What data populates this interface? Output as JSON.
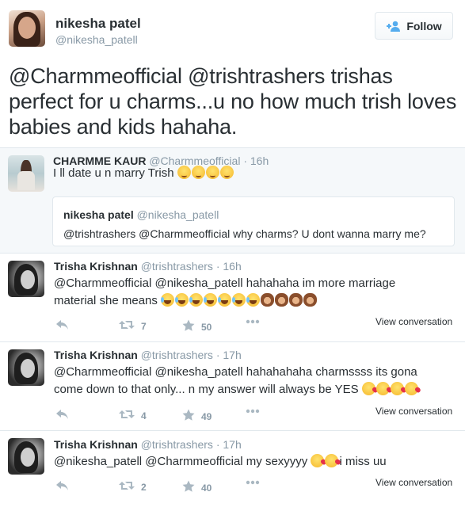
{
  "main_tweet": {
    "author_name": "nikesha patel",
    "author_handle": "@nikesha_patell",
    "follow_label": "Follow",
    "text": "@Charmmeofficial @trishtrashers trishas perfect for u charms...u no how much trish loves babies and kids hahaha."
  },
  "quoted": {
    "author_name": "CHARMME KAUR",
    "author_handle": "@Charmmeofficial",
    "time": "16h",
    "text": "I ll date u n marry Trish",
    "emojis": [
      "wink",
      "wink",
      "wink",
      "wink"
    ],
    "inner": {
      "author_name": "nikesha patel",
      "author_handle": "@nikesha_patell",
      "text": "@trishtrashers @Charmmeofficial why charms? U dont wanna marry me?"
    }
  },
  "replies": [
    {
      "author_name": "Trisha Krishnan",
      "author_handle": "@trishtrashers",
      "time": "16h",
      "text_line1": "@Charmmeofficial @nikesha_patell hahahaha im more marriage",
      "text_line2": "material she means",
      "emojis_line2": [
        "laugh",
        "laugh",
        "laugh",
        "laugh",
        "laugh",
        "laugh",
        "laugh",
        "monkey",
        "monkey",
        "monkey",
        "monkey"
      ],
      "retweets": "7",
      "favorites": "50",
      "view_label": "View conversation"
    },
    {
      "author_name": "Trisha Krishnan",
      "author_handle": "@trishtrashers",
      "time": "17h",
      "text_line1": "@Charmmeofficial @nikesha_patell hahahahaha charmssss its gona",
      "text_line2": "come down to that only... n my answer will always be YES",
      "emojis_line2": [
        "kiss",
        "kiss",
        "kiss",
        "kiss"
      ],
      "retweets": "4",
      "favorites": "49",
      "view_label": "View conversation"
    },
    {
      "author_name": "Trisha Krishnan",
      "author_handle": "@trishtrashers",
      "time": "17h",
      "text_line1": "@nikesha_patell @Charmmeofficial my sexyyyy",
      "emojis_line1": [
        "kiss",
        "kiss"
      ],
      "text_line1_after": "i miss uu",
      "retweets": "2",
      "favorites": "40",
      "view_label": "View conversation"
    }
  ],
  "icons": {
    "follow": "add-user-icon",
    "reply": "reply-icon",
    "retweet": "retweet-icon",
    "favorite": "star-icon",
    "more": "more-icon"
  },
  "colors": {
    "text": "#292f33",
    "muted": "#8899a6",
    "border": "#e1e8ed",
    "accent": "#55acee"
  }
}
